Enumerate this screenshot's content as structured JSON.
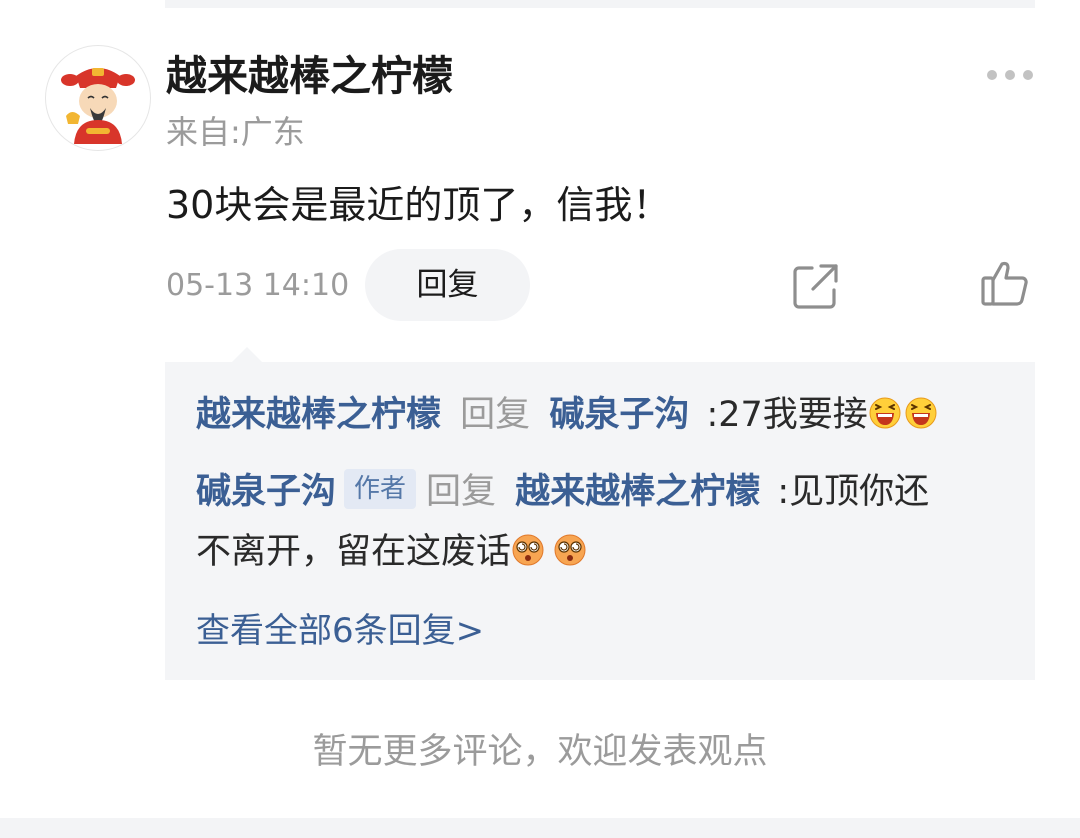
{
  "comment": {
    "username": "越来越棒之柠檬",
    "location": "来自:广东",
    "text": "30块会是最近的顶了，信我！",
    "timestamp": "05-13 14:10",
    "reply_label": "回复",
    "avatar_icon": "fortune-god-avatar",
    "more_icon": "more-dots-icon",
    "share_icon": "share-icon",
    "like_icon": "thumbs-up-icon"
  },
  "replies": [
    {
      "from": "越来越棒之柠檬",
      "verb": "回复",
      "to": "碱泉子沟",
      "text_line1": ":27我要接",
      "emoji": "laughing-emoji",
      "emoji_count": 2
    },
    {
      "from": "碱泉子沟",
      "tag": "作者",
      "verb": "回复",
      "to": "越来越棒之柠檬",
      "text_line1": ":见顶你还",
      "text_line2": "不离开，留在这废话",
      "emoji": "dizzy-emoji",
      "emoji_count": 2
    }
  ],
  "view_all": "查看全部6条回复>",
  "footer_text": "暂无更多评论，欢迎发表观点",
  "colors": {
    "link_blue": "#3b5f94",
    "muted_grey": "#9b9b9b",
    "reply_bg": "#f4f5f7"
  }
}
